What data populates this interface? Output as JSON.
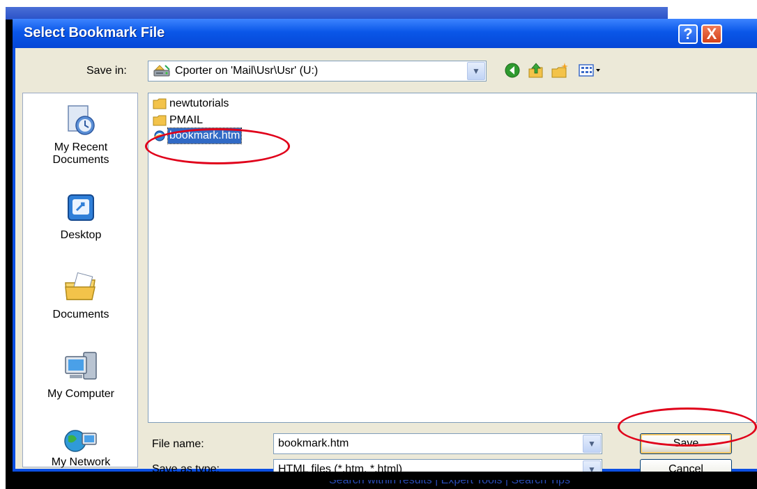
{
  "window": {
    "title": "Select Bookmark File",
    "help_glyph": "?",
    "close_glyph": "X"
  },
  "toolbar": {
    "save_in_label": "Save in:",
    "save_in_value": "Cporter on 'Mail\\Usr\\Usr' (U:)",
    "dropdown_glyph": "▼",
    "icons": [
      "back-icon",
      "up-folder-icon",
      "new-folder-icon",
      "views-menu-icon"
    ]
  },
  "places": [
    {
      "label_1": "My Recent",
      "label_2": "Documents",
      "icon": "recent-documents-icon"
    },
    {
      "label_1": "Desktop",
      "label_2": "",
      "icon": "desktop-icon"
    },
    {
      "label_1": "Documents",
      "label_2": "",
      "icon": "documents-icon"
    },
    {
      "label_1": "My Computer",
      "label_2": "",
      "icon": "my-computer-icon"
    },
    {
      "label_1": "My Network",
      "label_2": "",
      "icon": "my-network-icon"
    }
  ],
  "files": [
    {
      "name": "newtutorials",
      "type": "folder"
    },
    {
      "name": "PMAIL",
      "type": "folder"
    },
    {
      "name": "bookmark.htm",
      "type": "html",
      "selected": true
    }
  ],
  "form": {
    "file_name_label": "File name:",
    "file_name_value": "bookmark.htm",
    "save_type_label": "Save as type:",
    "save_type_value": "HTML files (*.htm, *.html)"
  },
  "buttons": {
    "save": "Save",
    "cancel": "Cancel"
  },
  "background_link": "Search within results  |  Expert Tools  |  Search Tips",
  "colors": {
    "title_bar": "#0a57e8",
    "client": "#ece9d8",
    "selection": "#316ac5",
    "annotation": "#e0001a"
  }
}
